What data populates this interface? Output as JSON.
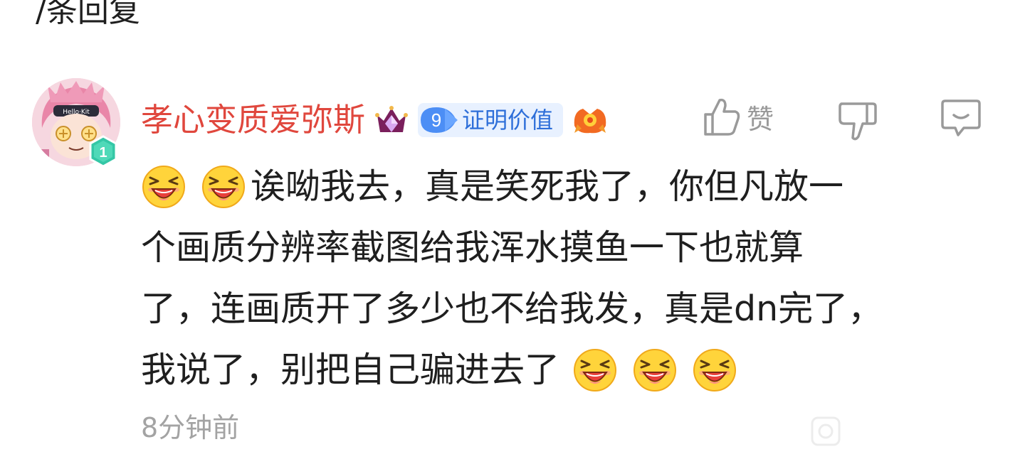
{
  "replies_header": "/条回复",
  "comment": {
    "username": "孝心变质爱弥斯",
    "user_level": "1",
    "badge": {
      "level": "9",
      "text": "证明价值"
    },
    "icons": {
      "vip": "crown-gem-icon",
      "game": "game-character-icon",
      "like": "thumbs-up-icon",
      "dislike": "thumbs-down-icon",
      "reply": "comment-bubble-icon",
      "emoji": "laughing-emoji-icon"
    },
    "like_label": "赞",
    "lines": [
      "诶呦我去，真是笑死我了，你但凡放一",
      "个画质分辨率截图给我浑水摸鱼一下也就算",
      "了，连画质开了多少也不给我发，真是dn完了，",
      "我说了，别把自己骗进去了"
    ],
    "timestamp": "8分钟前"
  },
  "colors": {
    "username": "#e0473d",
    "badge_bg": "#e8f1ff",
    "badge_text": "#2e6fd9",
    "badge_level": "#4c8ef5",
    "meta_gray": "#a3a3a3",
    "emoji_yellow": "#ffd43b"
  }
}
